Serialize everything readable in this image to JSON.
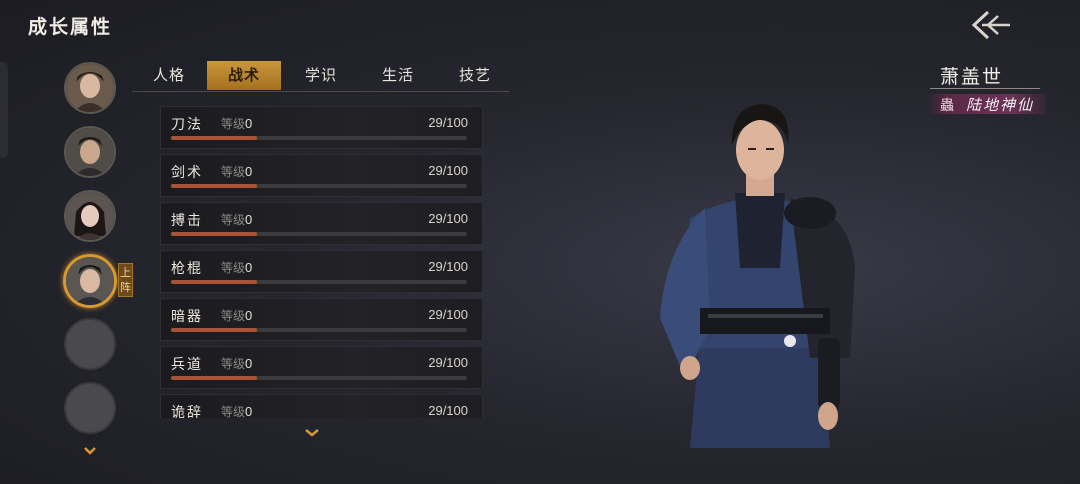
{
  "header": {
    "title": "成长属性"
  },
  "roster": {
    "deploy_tag": "上阵",
    "avatars": [
      {
        "state": "filled"
      },
      {
        "state": "filled"
      },
      {
        "state": "filled"
      },
      {
        "state": "selected"
      },
      {
        "state": "empty"
      },
      {
        "state": "empty"
      }
    ]
  },
  "tabs": [
    {
      "label": "人格",
      "active": false
    },
    {
      "label": "战术",
      "active": true
    },
    {
      "label": "学识",
      "active": false
    },
    {
      "label": "生活",
      "active": false
    },
    {
      "label": "技艺",
      "active": false
    }
  ],
  "skills": {
    "level_label": "等级",
    "items": [
      {
        "name": "刀法",
        "level": "0",
        "progress": "29/100",
        "fraction": 0.29
      },
      {
        "name": "剑术",
        "level": "0",
        "progress": "29/100",
        "fraction": 0.29
      },
      {
        "name": "搏击",
        "level": "0",
        "progress": "29/100",
        "fraction": 0.29
      },
      {
        "name": "枪棍",
        "level": "0",
        "progress": "29/100",
        "fraction": 0.29
      },
      {
        "name": "暗器",
        "level": "0",
        "progress": "29/100",
        "fraction": 0.29
      },
      {
        "name": "兵道",
        "level": "0",
        "progress": "29/100",
        "fraction": 0.29
      },
      {
        "name": "诡辞",
        "level": "0",
        "progress": "29/100",
        "fraction": 0.29
      }
    ]
  },
  "character": {
    "name": "萧盖世",
    "title": "陆地神仙",
    "title_icon": "蟲"
  },
  "icons": {
    "back": "back-arrow-icon",
    "more": "chevron-down-icon"
  },
  "colors": {
    "accent_gold": "#c9963c",
    "progress_fill": "#a8543a",
    "title_badge": "#5a2846"
  }
}
